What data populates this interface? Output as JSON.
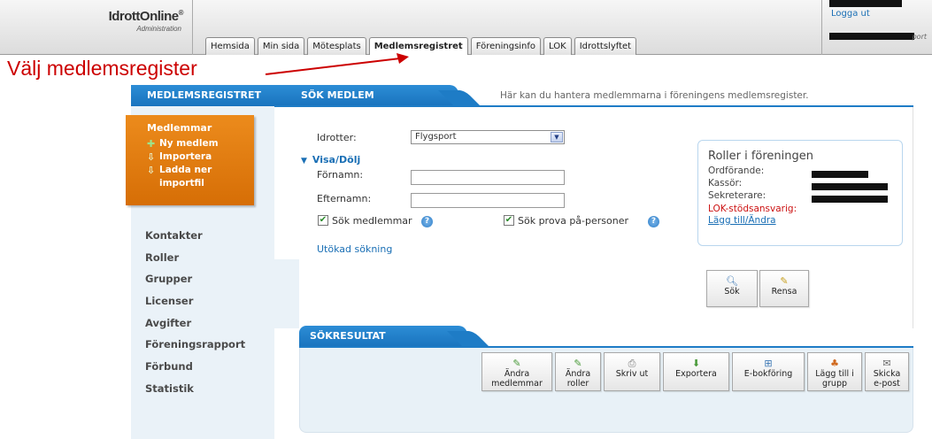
{
  "header": {
    "logo": "IdrottOnline",
    "logo_mark": "®",
    "logo_sub": "Administration",
    "logout": "Logga ut",
    "user_suffix": "port"
  },
  "tabs": [
    {
      "label": "Hemsida",
      "active": false
    },
    {
      "label": "Min sida",
      "active": false
    },
    {
      "label": "Mötesplats",
      "active": false
    },
    {
      "label": "Medlemsregistret",
      "active": true
    },
    {
      "label": "Föreningsinfo",
      "active": false
    },
    {
      "label": "LOK",
      "active": false
    },
    {
      "label": "Idrottslyftet",
      "active": false
    }
  ],
  "annotation": "Välj medlemsregister",
  "sidebar": {
    "heading": "MEDLEMSREGISTRET",
    "members_title": "Medlemmar",
    "members_items": [
      {
        "icon": "plus-icon",
        "label": "Ny medlem"
      },
      {
        "icon": "import-arrow-icon",
        "label": "Importera"
      },
      {
        "icon": "upload-arrow-icon",
        "label": "Ladda ner importfil"
      }
    ],
    "items": [
      "Kontakter",
      "Roller",
      "Grupper",
      "Licenser",
      "Avgifter",
      "Föreningsrapport",
      "Förbund",
      "Statistik"
    ]
  },
  "search": {
    "tab_label": "SÖK MEDLEM",
    "info_text": "Här kan du hantera medlemmarna i föreningens medlemsregister.",
    "sport_label": "Idrotter:",
    "sport_value": "Flygsport",
    "toggle_label": "Visa/Dölj",
    "firstname_label": "Förnamn:",
    "firstname_value": "",
    "lastname_label": "Efternamn:",
    "lastname_value": "",
    "cb_members": "Sök medlemmar",
    "cb_members_checked": true,
    "cb_trial": "Sök prova på-personer",
    "cb_trial_checked": true,
    "extended": "Utökad sökning",
    "search_button": "Sök",
    "clear_button": "Rensa"
  },
  "roles": {
    "title": "Roller i föreningen",
    "rows": [
      "Ordförande:",
      "Kassör:",
      "Sekreterare:"
    ],
    "lok_label": "LOK-stödsansvarig:",
    "link": "Lägg till/Ändra"
  },
  "results": {
    "tab_label": "SÖKRESULTAT",
    "buttons": [
      {
        "icon": "pencil-icon",
        "label": "Ändra medlemmar"
      },
      {
        "icon": "pencil-icon",
        "label": "Ändra roller"
      },
      {
        "icon": "printer-icon",
        "label": "Skriv ut"
      },
      {
        "icon": "export-icon",
        "label": "Exportera"
      },
      {
        "icon": "book-icon",
        "label": "E-bokföring"
      },
      {
        "icon": "group-add-icon",
        "label": "Lägg till i grupp"
      },
      {
        "icon": "envelope-icon",
        "label": "Skicka e-post"
      }
    ]
  },
  "colors": {
    "accent_blue": "#1e7cc6",
    "orange": "#e07a10",
    "annotation_red": "#cc0000",
    "link_blue": "#1a6fb5"
  }
}
